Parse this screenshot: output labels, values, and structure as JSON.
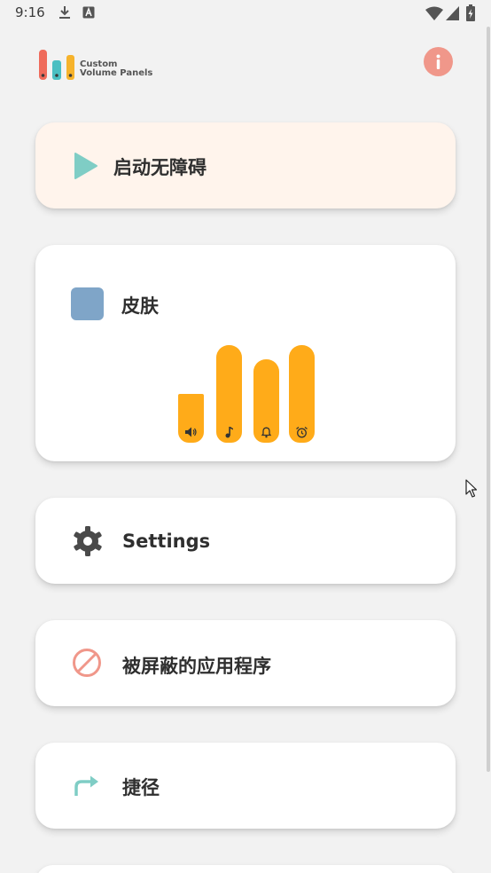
{
  "status_bar": {
    "time": "9:16"
  },
  "header": {
    "logo_line1": "Custom",
    "logo_line2": "Volume Panels"
  },
  "menu": {
    "start_accessibility": "启动无障碍",
    "skin": "皮肤",
    "settings": "Settings",
    "blocked_apps": "被屏蔽的应用程序",
    "shortcuts": "捷径"
  },
  "volume_levels": {
    "media": 0.5,
    "music": 1.0,
    "ring": 0.85,
    "alarm": 1.0
  },
  "colors": {
    "accent_orange": "#ffab19",
    "play_teal": "#7fcdc5",
    "info_salmon": "#f0978a",
    "skin_swatch": "#7fa5c8",
    "start_card_bg": "#fff4ec"
  }
}
